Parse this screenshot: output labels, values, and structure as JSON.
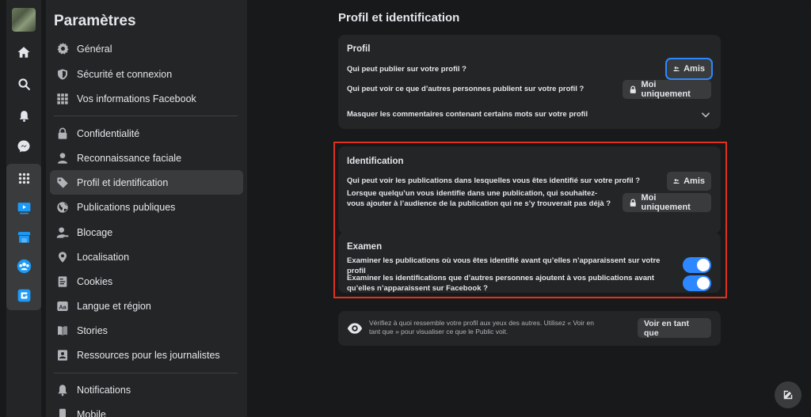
{
  "sidebar": {
    "title": "Paramètres",
    "items": [
      {
        "label": "Général",
        "icon": "gear-icon"
      },
      {
        "label": "Sécurité et connexion",
        "icon": "shield-icon"
      },
      {
        "label": "Vos informations Facebook",
        "icon": "grid-icon"
      },
      {
        "label": "Confidentialité",
        "icon": "lock-icon"
      },
      {
        "label": "Reconnaissance faciale",
        "icon": "face-icon"
      },
      {
        "label": "Profil et identification",
        "icon": "tag-icon"
      },
      {
        "label": "Publications publiques",
        "icon": "globe-icon"
      },
      {
        "label": "Blocage",
        "icon": "block-user-icon"
      },
      {
        "label": "Localisation",
        "icon": "location-pin-icon"
      },
      {
        "label": "Cookies",
        "icon": "cookie-icon"
      },
      {
        "label": "Langue et région",
        "icon": "language-icon"
      },
      {
        "label": "Stories",
        "icon": "book-icon"
      },
      {
        "label": "Ressources pour les journalistes",
        "icon": "journalist-icon"
      },
      {
        "label": "Notifications",
        "icon": "bell-icon"
      },
      {
        "label": "Mobile",
        "icon": "mobile-icon"
      }
    ]
  },
  "main": {
    "title": "Profil et identification",
    "profil": {
      "title": "Profil",
      "row1": "Qui peut publier sur votre profil ?",
      "row1_btn": "Amis",
      "row2": "Qui peut voir ce que d’autres personnes publient sur votre profil ?",
      "row2_btn": "Moi uniquement",
      "row3": "Masquer les commentaires contenant certains mots sur votre profil"
    },
    "identification": {
      "title": "Identification",
      "row1": "Qui peut voir les publications dans lesquelles vous êtes identifié sur votre profil ?",
      "row1_btn": "Amis",
      "row2": "Lorsque quelqu’un vous identifie dans une publication, qui souhaitez-vous ajouter à l’audience de la publication qui ne s’y trouverait pas déjà ?",
      "row2_btn": "Moi uniquement"
    },
    "examen": {
      "title": "Examen",
      "row1": "Examiner les publications où vous êtes identifié avant qu’elles n’apparaissent sur votre profil",
      "row2": "Examiner les identifications que d’autres personnes ajoutent à vos publications avant qu’elles n’apparaissent sur Facebook ?"
    },
    "view_as": {
      "text": "Vérifiez à quoi ressemble votre profil aux yeux des autres. Utilisez « Voir en tant que » pour visualiser ce que le Public voit.",
      "button": "Voir en tant que"
    }
  },
  "colors": {
    "accent": "#2d88ff",
    "highlight_box": "#e0321c",
    "card_bg": "#242526",
    "page_bg": "#18191a"
  }
}
